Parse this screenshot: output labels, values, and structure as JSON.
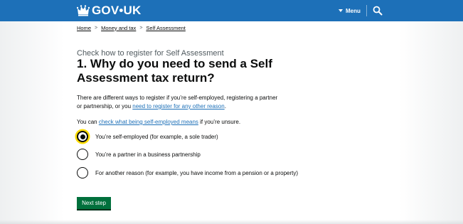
{
  "header": {
    "logo_text": "GOV•UK",
    "menu_label": "Menu",
    "search_icon": "search-icon",
    "crown_icon": "crown-icon",
    "brand_color": "#1d70b8"
  },
  "breadcrumb": [
    {
      "label": "Home"
    },
    {
      "label": "Money and tax"
    },
    {
      "label": "Self Assessment"
    }
  ],
  "caption": "Check how to register for Self Assessment",
  "title": "1. Why do you need to send a Self Assessment tax return?",
  "intro": {
    "text_before": "There are different ways to register if you’re self-employed, registering a partner or partnership, or you ",
    "link": "need to register for any other reason",
    "text_after": "."
  },
  "help": {
    "text_before": "You can ",
    "link": "check what being self-employed means",
    "text_after": " if you’re unsure."
  },
  "options": [
    {
      "label": "You’re self-employed (for example, a sole trader)",
      "checked": true
    },
    {
      "label": "You’re a partner in a business partnership",
      "checked": false
    },
    {
      "label": "For another reason (for example, you have income from a pension or a property)",
      "checked": false
    }
  ],
  "submit_label": "Next step",
  "colors": {
    "button": "#00703c",
    "focus": "#ffdd00",
    "link": "#1d70b8"
  }
}
